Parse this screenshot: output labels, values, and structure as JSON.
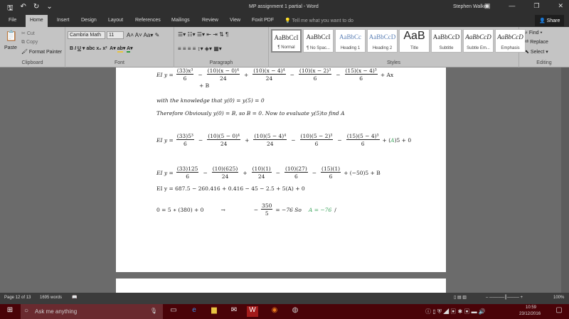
{
  "window": {
    "title": "MP assignment 1 partial - Word",
    "user": "Stephen Walker"
  },
  "tabs": [
    "File",
    "Home",
    "Insert",
    "Design",
    "Layout",
    "References",
    "Mailings",
    "Review",
    "View",
    "Foxit PDF"
  ],
  "tell_me": "Tell me what you want to do",
  "share": "Share",
  "clipboard": {
    "paste": "Paste",
    "cut": "Cut",
    "copy": "Copy",
    "format_painter": "Format Painter",
    "label": "Clipboard"
  },
  "font": {
    "name": "Cambria Math",
    "size": "11",
    "label": "Font"
  },
  "paragraph": {
    "label": "Paragraph"
  },
  "styles": {
    "label": "Styles",
    "items": [
      {
        "preview": "AaBbCcI",
        "name": "¶ Normal"
      },
      {
        "preview": "AaBbCcI",
        "name": "¶ No Spac..."
      },
      {
        "preview": "AaBbCc",
        "name": "Heading 1"
      },
      {
        "preview": "AaBbCcD",
        "name": "Heading 2"
      },
      {
        "preview": "AaB",
        "name": "Title"
      },
      {
        "preview": "AaBbCcD",
        "name": "Subtitle"
      },
      {
        "preview": "AaBbCcD",
        "name": "Subtle Em..."
      },
      {
        "preview": "AaBbCcD",
        "name": "Emphasis"
      }
    ]
  },
  "editing": {
    "find": "Find",
    "replace": "Replace",
    "select": "Select",
    "label": "Editing"
  },
  "doc": {
    "eq1": {
      "lhs": "EI y =",
      "terms": [
        {
          "op": "",
          "n": "(33)x³",
          "d": "6"
        },
        {
          "op": "−",
          "n": "(10)(x − 0)⁴",
          "d": "24"
        },
        {
          "op": "+",
          "n": "(10)(x − 4)⁴",
          "d": "24"
        },
        {
          "op": "−",
          "n": "(10)(x − 2)³",
          "d": "6"
        },
        {
          "op": "−",
          "n": "(15)(x − 4)³",
          "d": "6"
        }
      ],
      "tail": "+ Ax",
      "wrap": "+ B"
    },
    "line1": "with the knowledge that y(0) = y(5) = 0",
    "line2": "Therefore Obviously  y(0) = B, so B = 0. Now to evaluate y(5)to find A",
    "eq2": {
      "lhs": "EI y =",
      "terms": [
        {
          "op": "",
          "n": "(33)5³",
          "d": "6"
        },
        {
          "op": "−",
          "n": "(10)(5 − 0)⁴",
          "d": "24"
        },
        {
          "op": "+",
          "n": "(10)(5 − 4)⁴",
          "d": "24"
        },
        {
          "op": "−",
          "n": "(10)(5 − 2)³",
          "d": "6"
        },
        {
          "op": "−",
          "n": "(15)(5 − 4)³",
          "d": "6"
        }
      ],
      "tail_a": "+ (",
      "tail_green": "A",
      "tail_b": ")5 + 0"
    },
    "eq3": {
      "lhs": "EI y =",
      "terms": [
        {
          "op": "",
          "n": "(33)125",
          "d": "6"
        },
        {
          "op": "−",
          "n": "(10)(625)",
          "d": "24"
        },
        {
          "op": "+",
          "n": "(10)(1)",
          "d": "24"
        },
        {
          "op": "−",
          "n": "(10)(27)",
          "d": "6"
        },
        {
          "op": "−",
          "n": "(15)(1)",
          "d": "6"
        }
      ],
      "tail": "+ (−50)5 + B"
    },
    "line3": "EI y = 687.5 − 260.416 + 0.416 − 45 − 2.5 + 5(A) + 0",
    "final": {
      "left": "0 =  5 ∗ (380) + 0",
      "arrow": "→",
      "minus": "−",
      "n": "350",
      "d": "5",
      "mid": "= −76  So",
      "green": "A = −76",
      "cursor": "/"
    }
  },
  "status": {
    "page": "Page 12 of 13",
    "words": "1695 words",
    "zoom": "100%"
  },
  "taskbar": {
    "search": "Ask me anything",
    "time": "10:59",
    "date": "23/12/2016"
  },
  "colors": {
    "title_bar": "#2f2f2f",
    "ribbon": "#c4c4c4",
    "taskbar": "#4a0308",
    "math_green": "#3aa35a"
  }
}
